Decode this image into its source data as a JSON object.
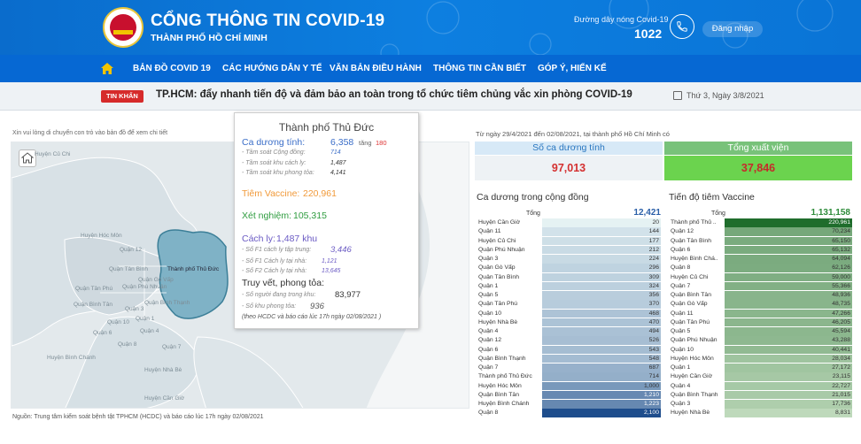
{
  "header": {
    "site_title": "CỔNG THÔNG TIN COVID-19",
    "site_subtitle": "THÀNH PHỐ HỒ CHÍ MINH",
    "hotline_label": "Đường dây nóng Covid-19",
    "hotline_number": "1022",
    "login_label": "Đăng nhập",
    "colors": {
      "header_bg": "#0a74d6",
      "nav_bg": "#0668d3",
      "accent": "#f1c400"
    }
  },
  "nav": {
    "items": [
      "BẢN ĐỒ COVID 19",
      "CÁC HƯỚNG DẪN Y TẾ",
      "VĂN BẢN ĐIỀU HÀNH",
      "THÔNG TIN CẦN BIẾT",
      "GÓP Ý, HIẾN KẾ"
    ]
  },
  "news": {
    "tag": "TIN KHẨN",
    "headline": "TP.HCM: đẩy nhanh tiến độ và đảm bảo an toàn trong tổ chức tiêm chủng vắc xin phòng COVID-19",
    "date": "Thứ 3, Ngày 3/8/2021"
  },
  "map": {
    "hint": "Xin vui lòng di chuyển con trỏ vào bản đồ để xem chi tiết",
    "labels": [
      "Huyện Củ Chi",
      "Huyện Hóc Môn",
      "Quận 12",
      "Quận Gò Vấp",
      "Quận Bình Thạnh",
      "Quận Phú Nhuận",
      "Quận Tân Bình",
      "Quận Tân Phú",
      "Quận Bình Tân",
      "Quận 1",
      "Quận 3",
      "Quận 10",
      "Quận 4",
      "Quận 6",
      "Quận 8",
      "Quận 7",
      "Huyện Bình Chánh",
      "Huyện Nhà Bè",
      "Thành phố Thủ Đức",
      "Huyện Cần Giờ"
    ],
    "source": "Nguồn: Trung tâm kiểm soát bệnh tật TPHCM (HCDC) và báo cáo lúc 17h ngày 02/08/2021"
  },
  "tooltip": {
    "title": "Thành phố Thủ Đức",
    "cases_label": "Ca dương tính:",
    "cases_value": "6,358",
    "cases_increase_label": "tăng",
    "cases_increase": "180",
    "screen_community_label": "- Tầm soát Cộng đồng:",
    "screen_community_value": "714",
    "screen_isolation_label": "- Tầm soát khu cách ly:",
    "screen_isolation_value": "1,487",
    "screen_blockade_label": "- Tầm soát khu phong tỏa:",
    "screen_blockade_value": "4,141",
    "vaccine_label": "Tiêm Vaccine:",
    "vaccine_value": "220,961",
    "test_label": "Xét nghiệm:",
    "test_value": "105,315",
    "isolation_label": "Cách ly:",
    "isolation_value": "1,487 khu",
    "f1_central_label": "- Số F1 cách ly tập trung:",
    "f1_central_value": "3,446",
    "f1_home_label": "- Số F1 Cách ly tại nhà:",
    "f1_home_value": "1,121",
    "f2_home_label": "- Số F2 Cách ly tại nhà:",
    "f2_home_value": "13,645",
    "trace_label": "Truy vết,  phong tỏa:",
    "people_area_label": "- Số người đang trong khu:",
    "people_area_value": "83,977",
    "blocked_areas_label": "- Số khu phong tỏa:",
    "blocked_areas_value": "936",
    "note": "(theo HCDC và  báo cáo lúc 17h ngày 02/08/2021 )"
  },
  "summary": {
    "range": "Từ ngày 29/4/2021 đến 02/08/2021, tại thành phố Hồ Chí Minh có",
    "positive_label": "Số ca dương tính",
    "positive_value": "97,013",
    "discharged_label": "Tổng xuất viện",
    "discharged_value": "37,846"
  },
  "chart_data": [
    {
      "type": "bar",
      "title": "Ca dương trong cộng đồng",
      "total_label": "Tổng",
      "total": 12421,
      "total_text": "12,421",
      "categories": [
        "Huyện Cần Giờ",
        "Quận 11",
        "Huyện Củ Chi",
        "Quận Phú Nhuận",
        "Quận 3",
        "Quận Gò Vấp",
        "Quận Tân Bình",
        "Quận 1",
        "Quận 5",
        "Quận Tân Phú",
        "Quận 10",
        "Huyện Nhà Bè",
        "Quận 4",
        "Quận 12",
        "Quận 6",
        "Quận Bình Thạnh",
        "Quận 7",
        "Thành phố Thủ Đức",
        "Huyện Hóc Môn",
        "Quận Bình Tân",
        "Huyện Bình Chánh",
        "Quận 8"
      ],
      "values": [
        20,
        144,
        177,
        212,
        224,
        296,
        309,
        324,
        356,
        370,
        468,
        470,
        494,
        526,
        543,
        548,
        687,
        714,
        1000,
        1210,
        1223,
        2100
      ],
      "labels": [
        "20",
        "144",
        "177",
        "212",
        "224",
        "296",
        "309",
        "324",
        "356",
        "370",
        "468",
        "470",
        "494",
        "526",
        "543",
        "548",
        "687",
        "714",
        "1,000",
        "1,210",
        "1,223",
        "2,100"
      ],
      "colors": {
        "low": "#eaf6f6",
        "high": "#1e4d8c"
      }
    },
    {
      "type": "bar",
      "title": "Tiến độ tiêm Vaccine",
      "total_label": "Tổng",
      "total": 1131158,
      "total_text": "1,131,158",
      "categories": [
        "Thành phố Thủ ..",
        "Quận 12",
        "Quận Tân Bình",
        "Quận 6",
        "Huyện Bình Chá..",
        "Quận 8",
        "Huyện Củ Chi",
        "Quận 7",
        "Quận Bình Tân",
        "Quận Gò Vấp",
        "Quận 11",
        "Quận Tân Phú",
        "Quận 5",
        "Quận Phú Nhuận",
        "Quận 10",
        "Huyện Hóc Môn",
        "Quận 1",
        "Huyện Cần Giờ",
        "Quận 4",
        "Quận Bình Thạnh",
        "Quận 3",
        "Huyện Nhà Bè"
      ],
      "values": [
        220961,
        70234,
        65150,
        65132,
        64094,
        62126,
        59000,
        55366,
        48936,
        48735,
        47266,
        46205,
        45594,
        43288,
        40441,
        28034,
        27172,
        23115,
        22727,
        21015,
        17736,
        8831
      ],
      "labels": [
        "220,961",
        "70,234",
        "65,150",
        "65,132",
        "64,094",
        "62,126",
        "59,000",
        "55,366",
        "48,936",
        "48,735",
        "47,266",
        "46,205",
        "45,594",
        "43,288",
        "40,441",
        "28,034",
        "27,172",
        "23,115",
        "22,727",
        "21,015",
        "17,736",
        "8,831"
      ],
      "colors": {
        "low": "#e6f4df",
        "high": "#1f6d2c"
      }
    }
  ]
}
